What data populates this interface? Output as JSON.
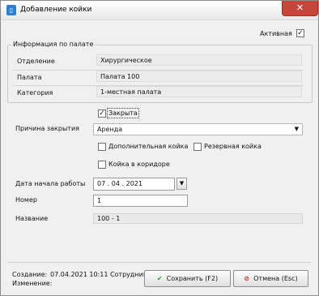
{
  "window": {
    "title": "Добавление койки",
    "close_glyph": "✕"
  },
  "active": {
    "label": "Активная",
    "checked": true
  },
  "ward_info": {
    "title": "Информация по палате",
    "department_label": "Отделение",
    "department_value": "Хирургическое",
    "ward_label": "Палата",
    "ward_value": "Палата 100",
    "category_label": "Категория",
    "category_value": "1-местная палата"
  },
  "closed": {
    "label": "Закрыта",
    "checked": true
  },
  "close_reason": {
    "label": "Причина закрытия",
    "value": "Аренда"
  },
  "options": {
    "additional_bed": {
      "label": "Дополнительная койка",
      "checked": false
    },
    "reserve_bed": {
      "label": "Резервная койка",
      "checked": false
    },
    "corridor_bed": {
      "label": "Койка в коридоре",
      "checked": false
    }
  },
  "start_date": {
    "label": "Дата начала работы",
    "value": "07 . 04 . 2021"
  },
  "number": {
    "label": "Номер",
    "value": "1"
  },
  "name": {
    "label": "Название",
    "value": "100 - 1"
  },
  "footer": {
    "created_label": "Создание:",
    "created_value": "07.04.2021 10:11  Сотрудник",
    "changed_label": "Изменение:"
  },
  "buttons": {
    "save_label": "Сохранить (F2)",
    "cancel_label": "Отмена (Esc)"
  },
  "colors": {
    "save_icon": "#2e9b2e",
    "cancel_icon": "#d62020",
    "close_button": "#c7463c"
  }
}
